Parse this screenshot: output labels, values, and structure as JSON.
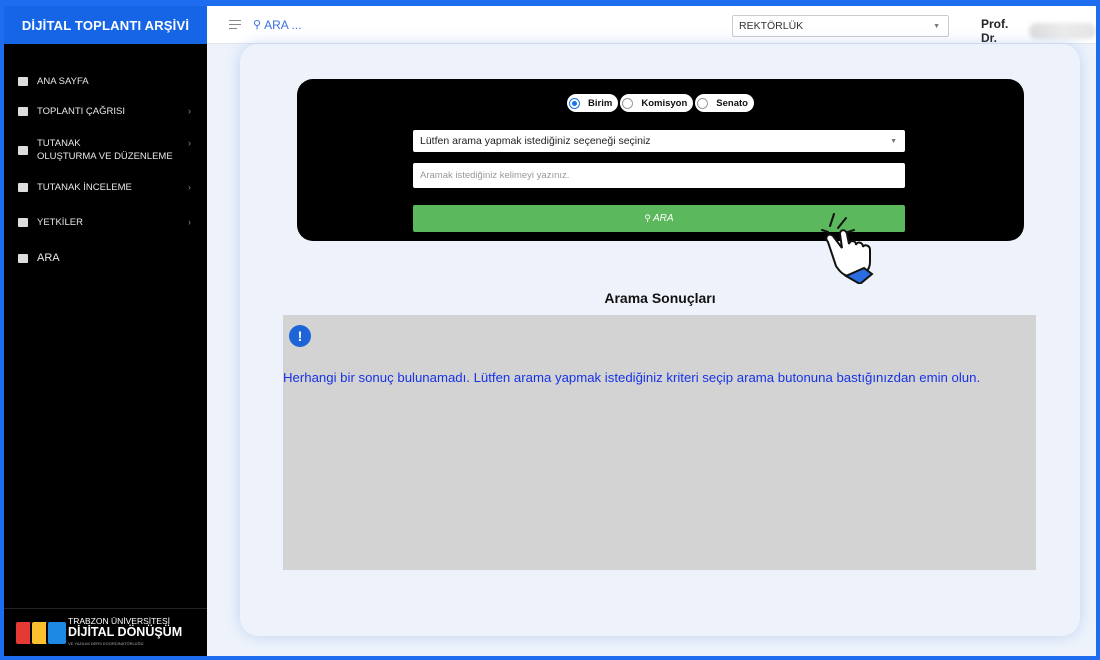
{
  "sidebar": {
    "brand": "DİJİTAL TOPLANTI ARŞİVİ",
    "items": [
      {
        "label": "ANA SAYFA",
        "icon": "grid-icon"
      },
      {
        "label": "TOPLANTI ÇAĞRISI",
        "icon": "id-card-icon",
        "chevron": "›"
      },
      {
        "label_line1": "TUTANAK",
        "label_line2": "OLUŞTURMA VE DÜZENLEME",
        "icon": "edit-document-icon",
        "chevron": "›"
      },
      {
        "label": "TUTANAK İNCELEME",
        "icon": "document-icon",
        "chevron": "›"
      },
      {
        "label": "YETKİLER",
        "icon": "id-card-icon",
        "chevron": "›"
      },
      {
        "label": "ARA",
        "icon": "search-list-icon"
      }
    ],
    "logo": {
      "line1": "TRABZON ÜNİVERSİTESİ",
      "line2": "DİJİTAL DÖNÜŞÜM",
      "line3": "VE YAZILIM DERS KOORDİNATÖRLÜĞÜ",
      "colors": [
        "#e53935",
        "#fbc02d",
        "#1e88e5"
      ]
    }
  },
  "topbar": {
    "search_icon": "⚲",
    "search_text": "ARA ...",
    "unit_selected": "REKTÖRLÜK",
    "user_name": "Prof. Dr."
  },
  "search": {
    "radios": [
      {
        "label": "Birim",
        "checked": true
      },
      {
        "label": "Komisyon",
        "checked": false
      },
      {
        "label": "Senato",
        "checked": false
      }
    ],
    "select_text": "Lütfen arama yapmak istediğiniz seçeneği seçiniz",
    "keyword_placeholder": "Aramak istediğiniz kelimeyi yazınız.",
    "button_icon": "⚲",
    "button_label": "ARA"
  },
  "results": {
    "title": "Arama Sonuçları",
    "alert_symbol": "!",
    "message": "Herhangi bir sonuç bulunamadı. Lütfen arama yapmak istediğiniz kriteri seçip arama butonuna bastığınızdan emin olun."
  },
  "colors": {
    "brand_blue": "#1565e6",
    "sidebar_bg": "#000000",
    "button_green": "#5cb85c",
    "message_blue": "#1733e6",
    "results_bg": "#d3d3d3"
  }
}
